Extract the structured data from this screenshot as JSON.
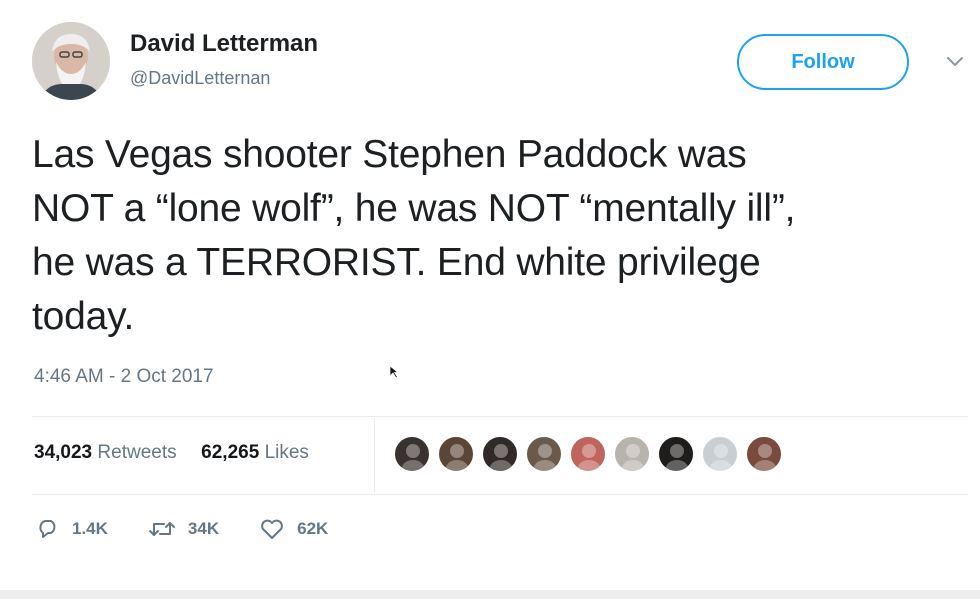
{
  "author": {
    "name": "David Letterman",
    "handle": "@DavidLetternan"
  },
  "follow_label": "Follow",
  "tweet": {
    "lines": [
      "Las Vegas shooter Stephen Paddock was",
      "NOT a “lone wolf”, he was NOT “mentally ill”,",
      "he was a TERRORIST. End white privilege",
      "today."
    ],
    "timestamp": "4:46 AM - 2 Oct 2017"
  },
  "stats": {
    "retweets_count": "34,023",
    "retweets_label": "Retweets",
    "likes_count": "62,265",
    "likes_label": "Likes"
  },
  "likers": [
    {
      "color": "#3a3230"
    },
    {
      "color": "#5b4536"
    },
    {
      "color": "#2f2a28"
    },
    {
      "color": "#6b5a4c"
    },
    {
      "color": "#c0645e"
    },
    {
      "color": "#b9b3ad"
    },
    {
      "color": "#1f1d1c"
    },
    {
      "color": "#c9ced3"
    },
    {
      "color": "#7a4a3c"
    }
  ],
  "actions": {
    "replies": "1.4K",
    "retweets": "34K",
    "likes": "62K"
  },
  "colors": {
    "accent": "#1da1f2",
    "muted": "#657786",
    "text": "#1c2022"
  },
  "icons": {
    "reply": "reply-icon",
    "retweet": "retweet-icon",
    "like": "heart-icon",
    "caret": "chevron-down-icon"
  }
}
